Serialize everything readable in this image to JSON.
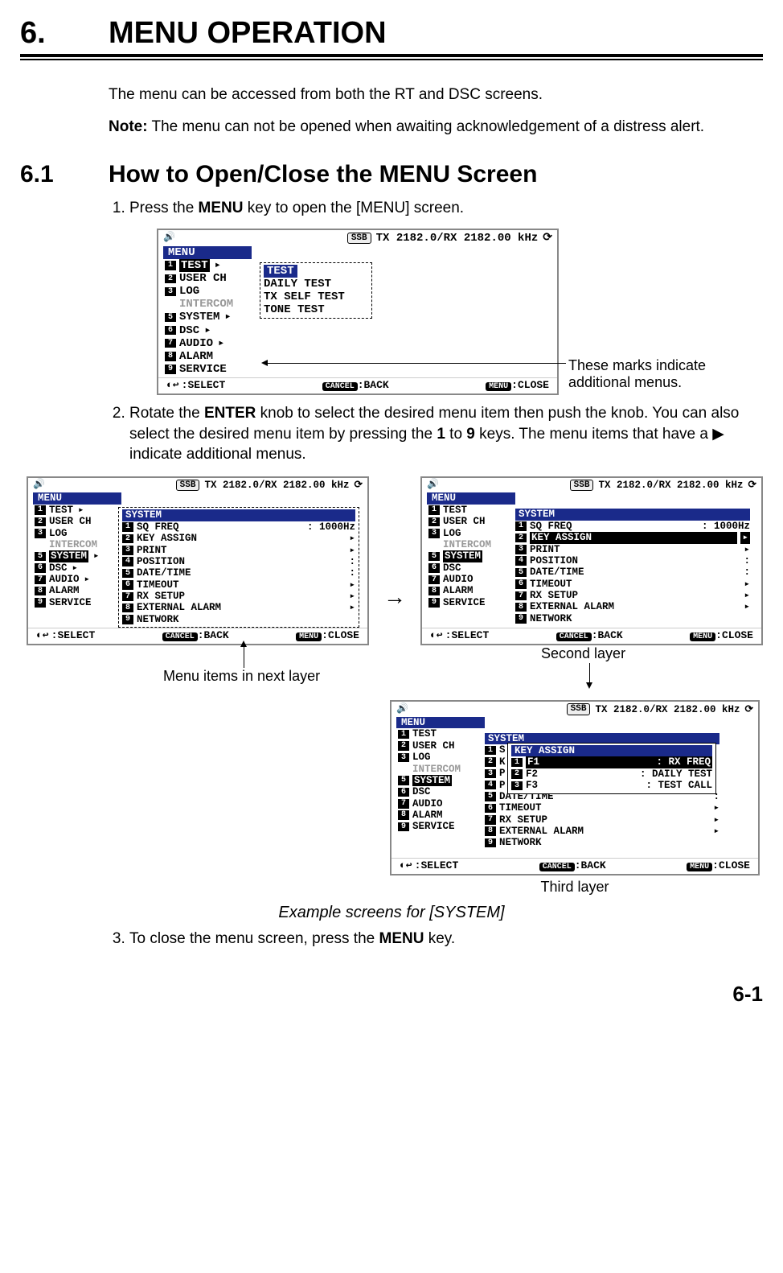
{
  "chapter": {
    "num": "6.",
    "title": "MENU OPERATION"
  },
  "intro1": "The menu can be accessed from both the RT and DSC screens.",
  "noteLabel": "Note:",
  "noteText": " The menu can not be opened when awaiting acknowledgement of a distress alert.",
  "section": {
    "num": "6.1",
    "title": "How to Open/Close the MENU Screen"
  },
  "step1_a": "Press the ",
  "step1_b": "MENU",
  "step1_c": " key to open the [MENU] screen.",
  "step2_a": "Rotate the ",
  "step2_b": "ENTER",
  "step2_c": " knob to select the desired menu item then push the knob. You can also select the desired menu item by pressing the ",
  "step2_d": "1",
  "step2_e": " to ",
  "step2_f": "9",
  "step2_g": " keys. The menu items that have a ▶ indicate additional menus.",
  "step3_a": "To close the menu screen, press the ",
  "step3_b": "MENU",
  "step3_c": " key.",
  "screen": {
    "ssb": "SSB",
    "freq": "TX 2182.0/RX 2182.00 kHz",
    "menuTitle": "MENU",
    "items": [
      {
        "n": "1",
        "label": "TEST",
        "arrow": true,
        "sel": true
      },
      {
        "n": "2",
        "label": "USER CH"
      },
      {
        "n": "3",
        "label": "LOG"
      },
      {
        "n": "",
        "label": "INTERCOM",
        "dim": true
      },
      {
        "n": "5",
        "label": "SYSTEM",
        "arrow": true
      },
      {
        "n": "6",
        "label": "DSC",
        "arrow": true
      },
      {
        "n": "7",
        "label": "AUDIO",
        "arrow": true
      },
      {
        "n": "8",
        "label": "ALARM"
      },
      {
        "n": "9",
        "label": "SERVICE"
      }
    ],
    "subTitle": "TEST",
    "subItems": [
      "DAILY TEST",
      "TX SELF TEST",
      "TONE TEST"
    ],
    "footSelect": ":SELECT",
    "footBack": ":BACK",
    "footClose": ":CLOSE",
    "footCancel": "CANCEL",
    "footMenu": "MENU"
  },
  "callout1a": "These marks indicate",
  "callout1b": "additional menus.",
  "sysScreen": {
    "title": "SYSTEM",
    "leftSel": "SYSTEM",
    "items": [
      {
        "n": "1",
        "label": "SQ FREQ",
        "val": ": 1000Hz"
      },
      {
        "n": "2",
        "label": "KEY ASSIGN",
        "arrow": true
      },
      {
        "n": "3",
        "label": "PRINT",
        "arrow": true
      },
      {
        "n": "4",
        "label": "POSITION",
        "val": ":"
      },
      {
        "n": "5",
        "label": "DATE/TIME",
        "val": ":"
      },
      {
        "n": "6",
        "label": "TIMEOUT",
        "arrow": true
      },
      {
        "n": "7",
        "label": "RX SETUP",
        "arrow": true
      },
      {
        "n": "8",
        "label": "EXTERNAL ALARM",
        "arrow": true
      },
      {
        "n": "9",
        "label": "NETWORK"
      }
    ]
  },
  "labelMenuItemsNext": "Menu items in next layer",
  "labelSecondLayer": "Second layer",
  "labelThirdLayer": "Third layer",
  "kaScreen": {
    "title": "KEY ASSIGN",
    "items": [
      {
        "n": "1",
        "label": "F1",
        "val": ": RX FREQ",
        "sel": true
      },
      {
        "n": "2",
        "label": "F2",
        "val": ": DAILY TEST"
      },
      {
        "n": "3",
        "label": "F3",
        "val": ": TEST CALL"
      }
    ]
  },
  "exampleCaption": "Example screens for [SYSTEM]",
  "pageNum": "6-1"
}
